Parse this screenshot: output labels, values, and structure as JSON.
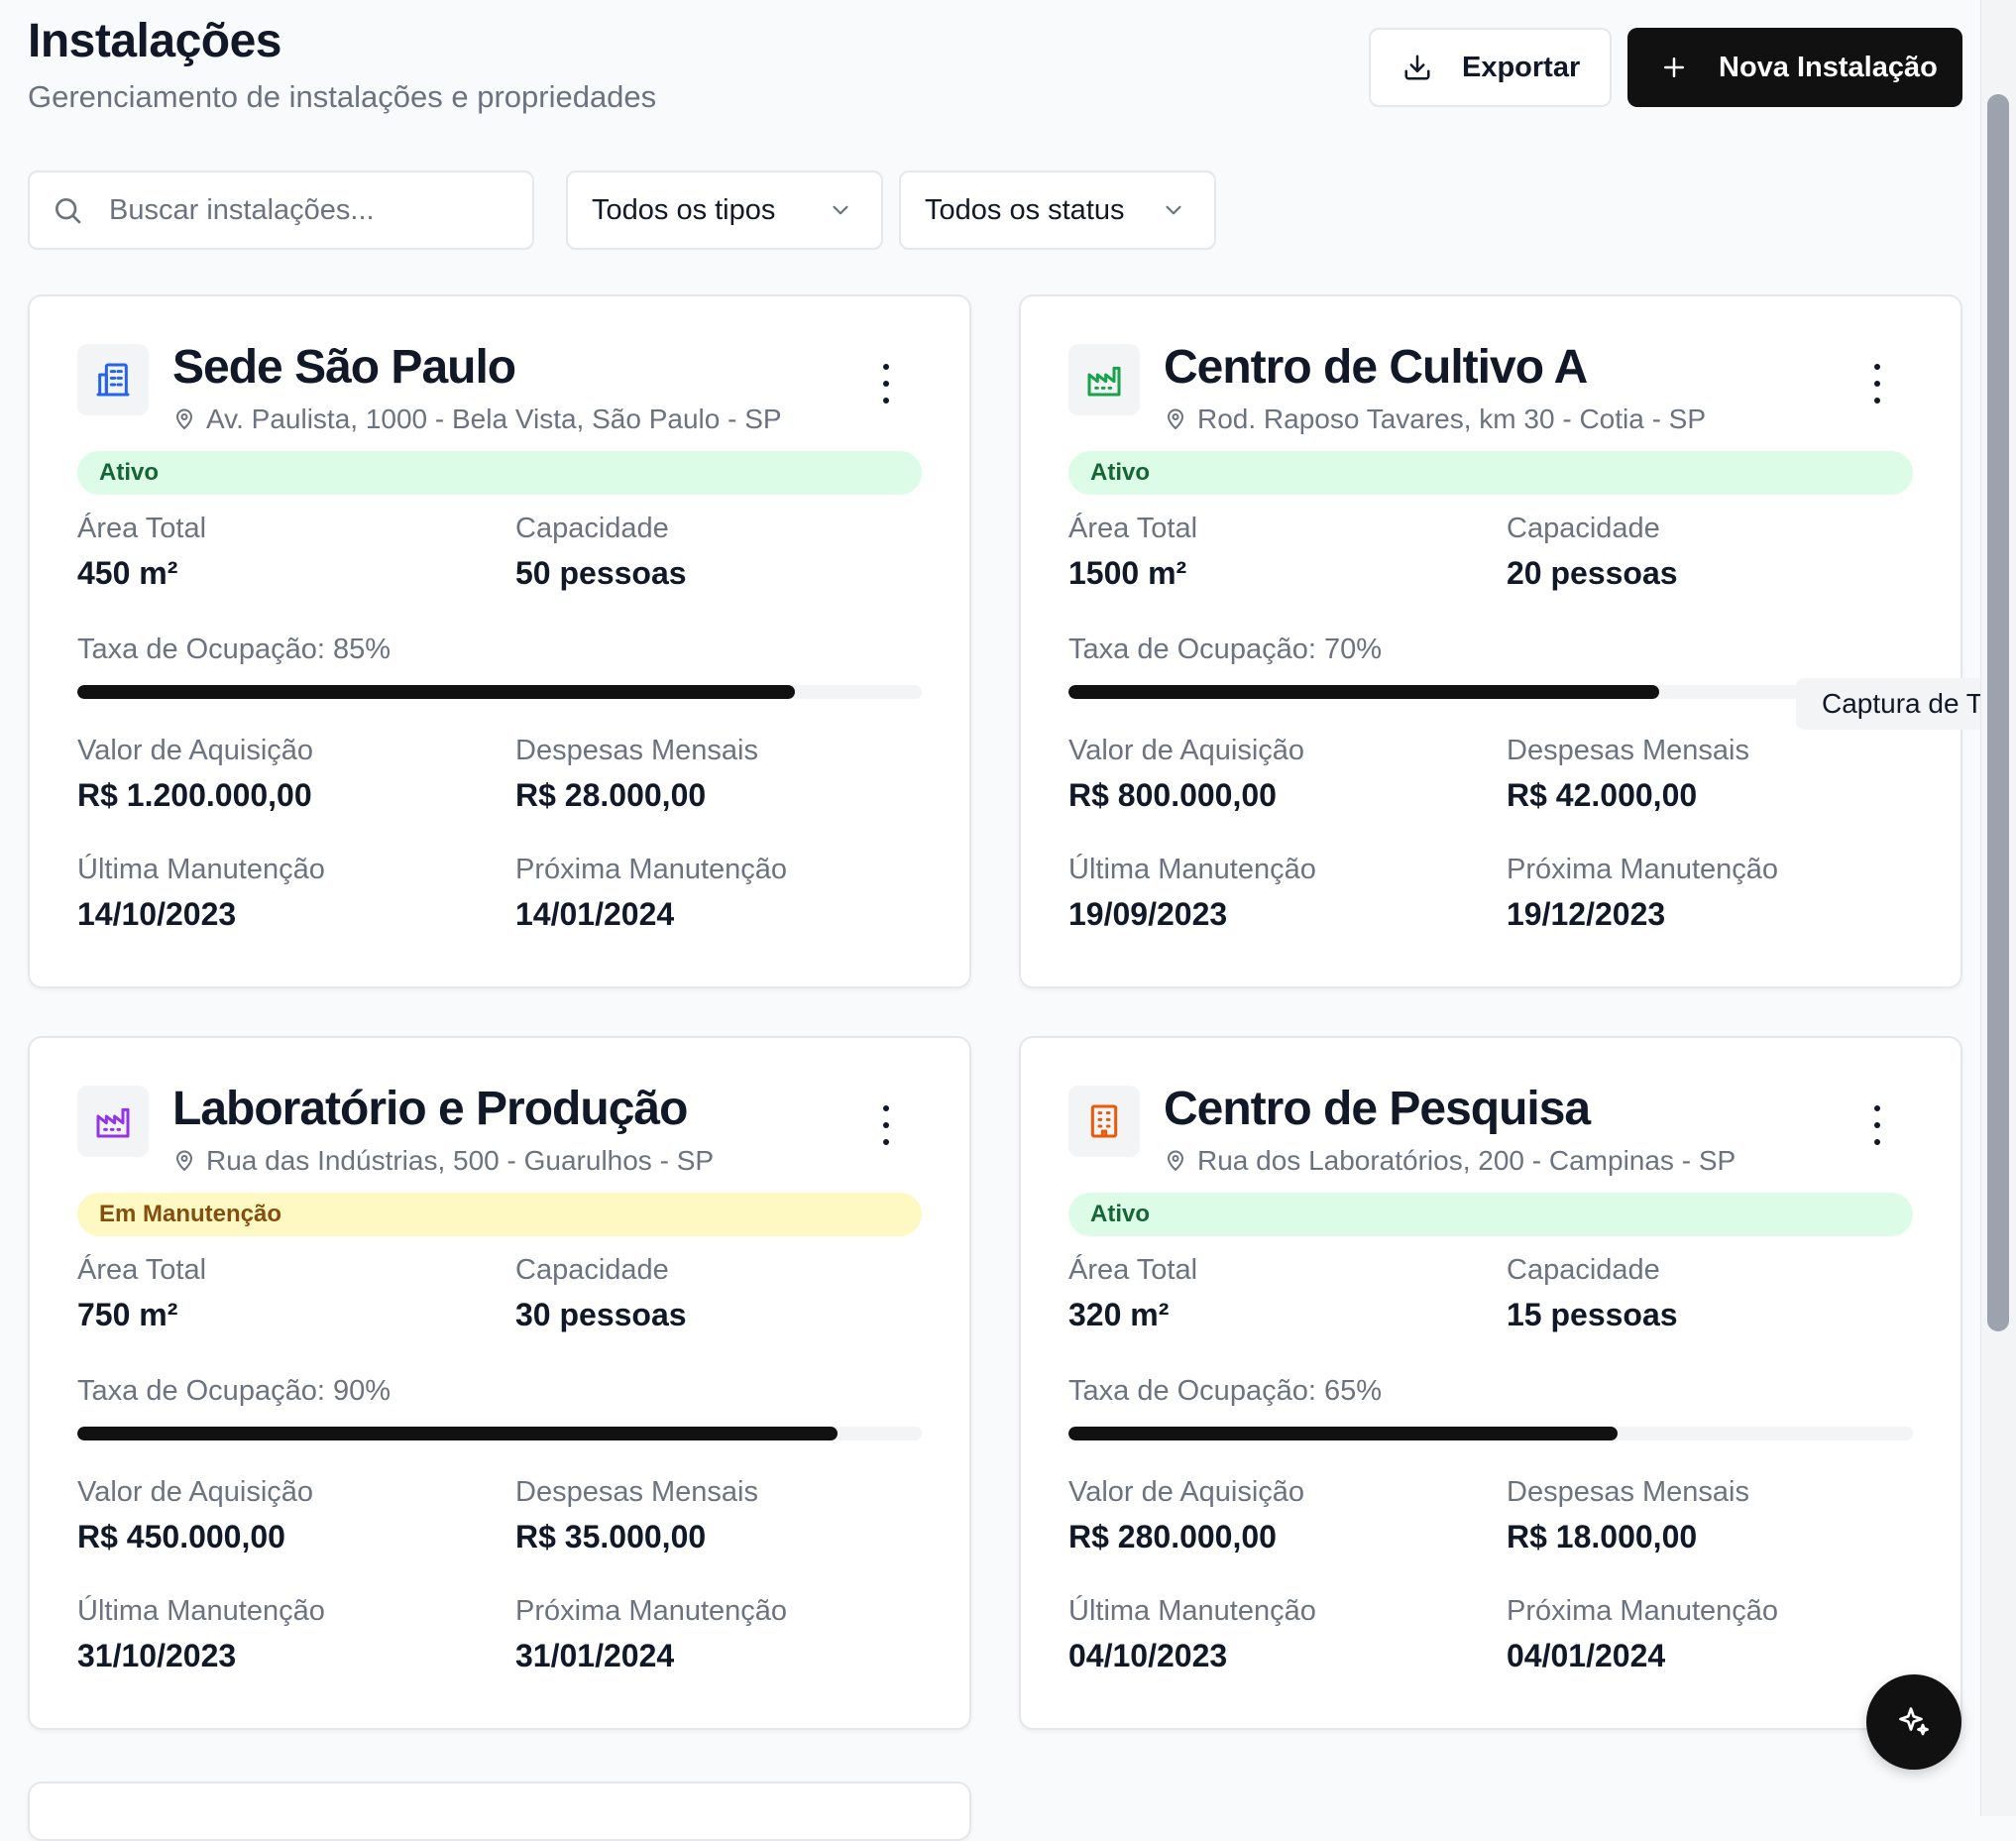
{
  "header": {
    "title": "Instalações",
    "subtitle": "Gerenciamento de instalações e propriedades",
    "export_label": "Exportar",
    "new_label": "Nova Instalação"
  },
  "filters": {
    "search_placeholder": "Buscar instalações...",
    "type_value": "Todos os tipos",
    "status_value": "Todos os status"
  },
  "labels": {
    "area": "Área Total",
    "capacity": "Capacidade",
    "acquisition": "Valor de Aquisição",
    "monthly": "Despesas Mensais",
    "last_maint": "Última Manutenção",
    "next_maint": "Próxima Manutenção"
  },
  "cards": [
    {
      "name": "Sede São Paulo",
      "address": "Av. Paulista, 1000 - Bela Vista, São Paulo - SP",
      "icon": "office-building-icon",
      "icon_color": "#2563eb",
      "status": "Ativo",
      "status_kind": "ok",
      "area": "450 m²",
      "capacity": "50 pessoas",
      "occupancy_text": "Taxa de Ocupação: 85%",
      "occupancy": 85,
      "acquisition": "R$ 1.200.000,00",
      "monthly": "R$ 28.000,00",
      "last_maint": "14/10/2023",
      "next_maint": "14/01/2024"
    },
    {
      "name": "Centro de Cultivo A",
      "address": "Rod. Raposo Tavares, km 30 - Cotia - SP",
      "icon": "factory-icon",
      "icon_color": "#16a34a",
      "status": "Ativo",
      "status_kind": "ok",
      "area": "1500 m²",
      "capacity": "20 pessoas",
      "occupancy_text": "Taxa de Ocupação: 70%",
      "occupancy": 70,
      "acquisition": "R$ 800.000,00",
      "monthly": "R$ 42.000,00",
      "last_maint": "19/09/2023",
      "next_maint": "19/12/2023"
    },
    {
      "name": "Laboratório e Produção",
      "address": "Rua das Indústrias, 500 - Guarulhos - SP",
      "icon": "factory-icon",
      "icon_color": "#9333ea",
      "status": "Em Manutenção",
      "status_kind": "warn",
      "area": "750 m²",
      "capacity": "30 pessoas",
      "occupancy_text": "Taxa de Ocupação: 90%",
      "occupancy": 90,
      "acquisition": "R$ 450.000,00",
      "monthly": "R$ 35.000,00",
      "last_maint": "31/10/2023",
      "next_maint": "31/01/2024"
    },
    {
      "name": "Centro de Pesquisa",
      "address": "Rua dos Laboratórios, 200 - Campinas - SP",
      "icon": "building-icon",
      "icon_color": "#ea580c",
      "status": "Ativo",
      "status_kind": "ok",
      "area": "320 m²",
      "capacity": "15 pessoas",
      "occupancy_text": "Taxa de Ocupação: 65%",
      "occupancy": 65,
      "acquisition": "R$ 280.000,00",
      "monthly": "R$ 18.000,00",
      "last_maint": "04/10/2023",
      "next_maint": "04/01/2024"
    }
  ],
  "tooltip": "Captura de Tela"
}
